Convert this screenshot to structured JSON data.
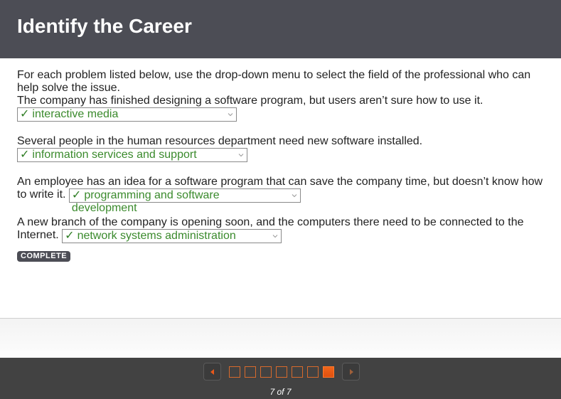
{
  "header": {
    "title": "Identify the Career"
  },
  "instructions": "For each problem listed below, use the drop-down menu to select the field of the professional who can help solve the issue.",
  "problems": [
    {
      "text": "The company has finished designing a software program, but users aren’t sure how to use it.",
      "answer": "interactive media",
      "status": "correct"
    },
    {
      "text": "Several people in the human resources department need new software installed.",
      "answer": "information services and support",
      "status": "correct"
    },
    {
      "text": "An employee has an idea for a software program that can save the company time, but doesn’t know how to write it.",
      "answer": "programming and software development",
      "status": "correct"
    },
    {
      "text": "A new branch of the company is opening soon, and the computers there need to be connected to the Internet.",
      "answer": "network systems administration",
      "status": "correct"
    }
  ],
  "icons": {
    "check": "✓",
    "chevron": "chevron-down-icon"
  },
  "complete_label": "COMPLETE",
  "pagination": {
    "current": 7,
    "total": 7,
    "counter_text": "7 of 7"
  },
  "colors": {
    "header_bg": "#4c4d55",
    "correct_green": "#3a8a2c",
    "accent_orange": "#e8581a",
    "nav_bg": "#424242"
  }
}
